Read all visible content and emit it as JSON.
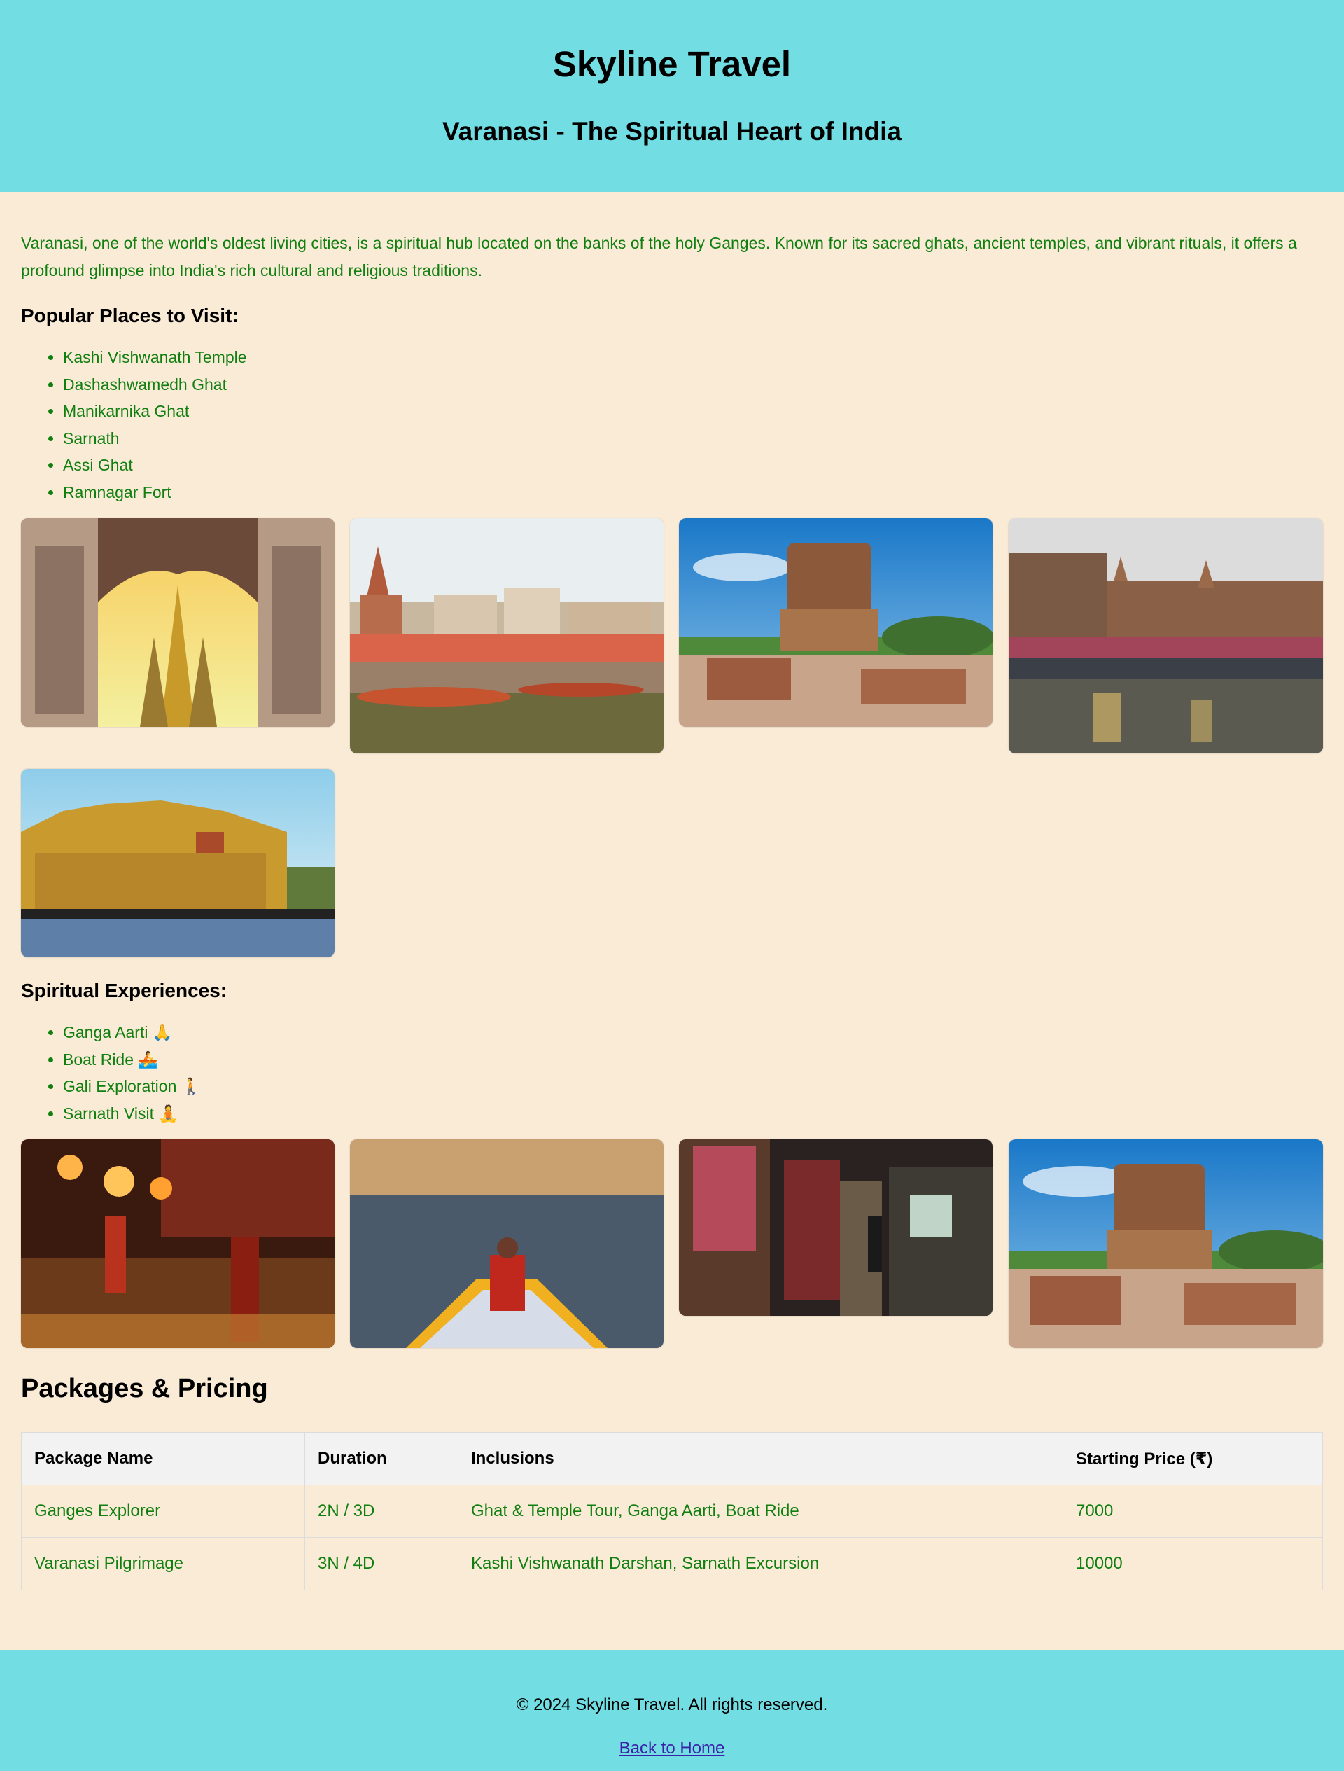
{
  "header": {
    "site_title": "Skyline Travel",
    "page_title": "Varanasi - The Spiritual Heart of India"
  },
  "intro": "Varanasi, one of the world's oldest living cities, is a spiritual hub located on the banks of the holy Ganges. Known for its sacred ghats, ancient temples, and vibrant rituals, it offers a profound glimpse into India's rich cultural and religious traditions.",
  "places": {
    "heading": "Popular Places to Visit:",
    "items": [
      "Kashi Vishwanath Temple",
      "Dashashwamedh Ghat",
      "Manikarnika Ghat",
      "Sarnath",
      "Assi Ghat",
      "Ramnagar Fort"
    ]
  },
  "experiences": {
    "heading": "Spiritual Experiences:",
    "items": [
      "Ganga Aarti 🙏",
      "Boat Ride 🚣",
      "Gali Exploration 🚶",
      "Sarnath Visit 🧘"
    ]
  },
  "pricing": {
    "heading": "Packages & Pricing",
    "columns": [
      "Package Name",
      "Duration",
      "Inclusions",
      "Starting Price (₹)"
    ],
    "rows": [
      [
        "Ganges Explorer",
        "2N / 3D",
        "Ghat & Temple Tour, Ganga Aarti, Boat Ride",
        "7000"
      ],
      [
        "Varanasi Pilgrimage",
        "3N / 4D",
        "Kashi Vishwanath Darshan, Sarnath Excursion",
        "10000"
      ]
    ]
  },
  "footer": {
    "copyright": "© 2024 Skyline Travel. All rights reserved.",
    "back_link": "Back to Home"
  },
  "colors": {
    "header_bg": "#72dde3",
    "page_bg": "#faebd7",
    "text_green": "#107f10",
    "link": "#3b1fa8"
  }
}
